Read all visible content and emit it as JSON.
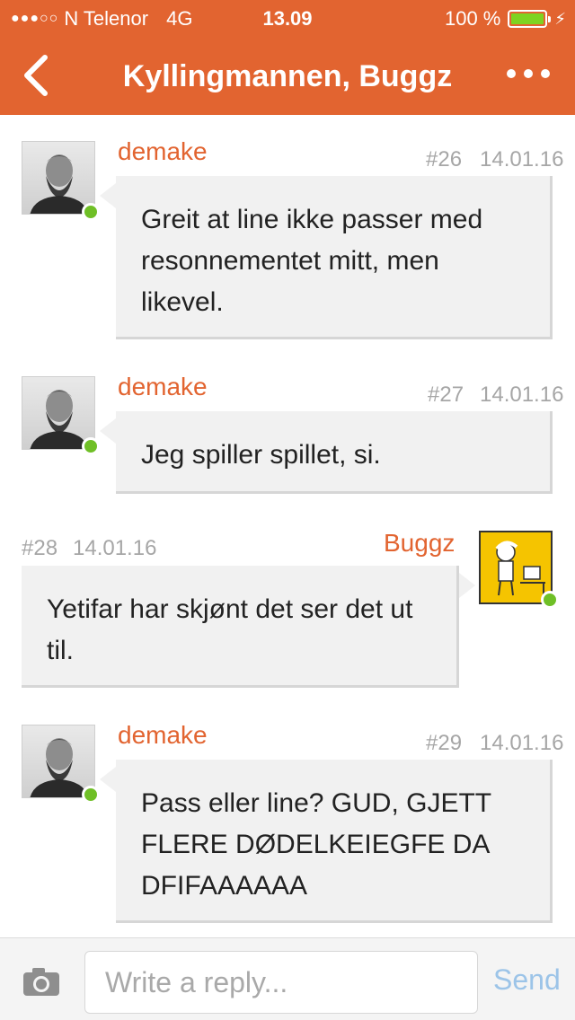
{
  "status_bar": {
    "carrier": "N Telenor",
    "network": "4G",
    "time": "13.09",
    "battery_percent": "100 %",
    "battery_level": 1.0
  },
  "header": {
    "title": "Kyllingmannen, Buggz",
    "back_icon": "chevron-left-icon",
    "more_icon": "ellipsis-icon"
  },
  "messages": [
    {
      "author": "demake",
      "number": "#26",
      "date": "14.01.16",
      "text": "Greit at line ikke passer med resonnementet mitt, men likevel.",
      "side": "left"
    },
    {
      "author": "demake",
      "number": "#27",
      "date": "14.01.16",
      "text": "Jeg spiller spillet, si.",
      "side": "left"
    },
    {
      "author": "Buggz",
      "number": "#28",
      "date": "14.01.16",
      "text": "Yetifar har skjønt det ser det ut til.",
      "side": "right"
    },
    {
      "author": "demake",
      "number": "#29",
      "date": "14.01.16",
      "text": "Pass eller line? GUD, GJETT FLERE DØDELKEIEGFE DA DFIFAAAAAA",
      "side": "left"
    }
  ],
  "composer": {
    "placeholder": "Write a reply...",
    "send_label": "Send",
    "camera_icon": "camera-icon"
  },
  "colors": {
    "accent": "#e26430",
    "online": "#6fbf26",
    "send": "#9cc4e8"
  }
}
